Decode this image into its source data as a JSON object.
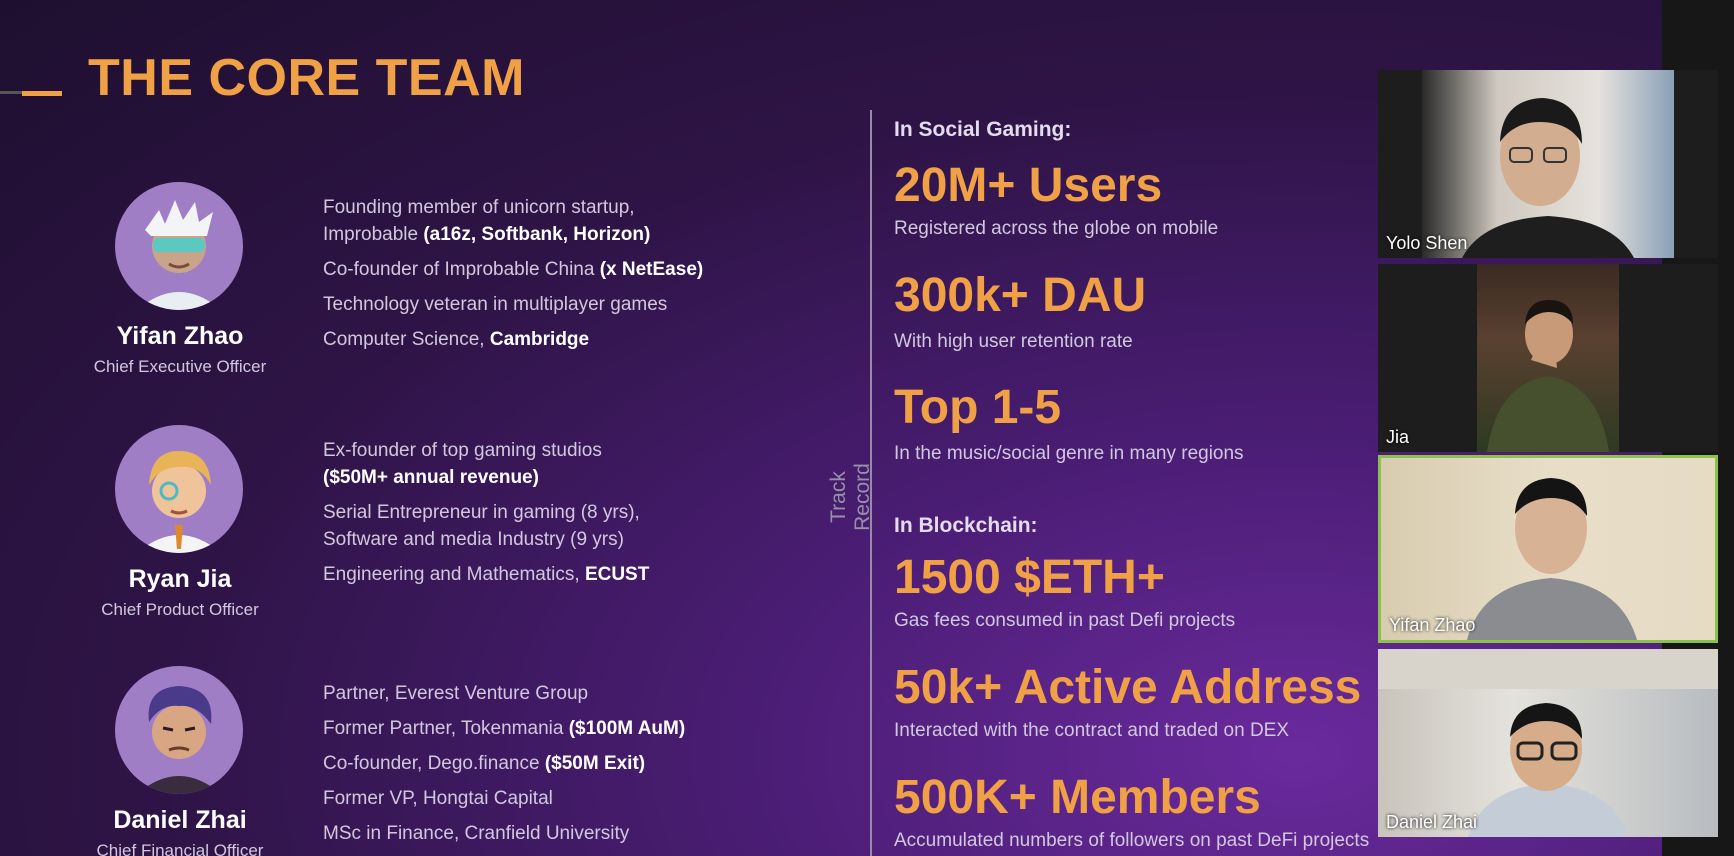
{
  "slide": {
    "title": "THE CORE TEAM",
    "team": [
      {
        "name": "Yifan Zhao",
        "role": "Chief Executive Officer",
        "bio": [
          {
            "text": "Founding member of unicorn startup,",
            "bold": ""
          },
          {
            "text": "Improbable ",
            "bold": "(a16z, Softbank, Horizon)"
          },
          {
            "text": "Co-founder of Improbable China ",
            "bold": "(x NetEase)"
          },
          {
            "text": "Technology veteran in multiplayer games",
            "bold": ""
          },
          {
            "text": "Computer Science, ",
            "bold": "Cambridge"
          }
        ]
      },
      {
        "name": "Ryan Jia",
        "role": "Chief Product Officer",
        "bio": [
          {
            "text": "Ex-founder of top gaming studios",
            "bold": ""
          },
          {
            "text": "",
            "bold": "($50M+ annual revenue)"
          },
          {
            "text": "Serial Entrepreneur in gaming (8 yrs),",
            "bold": ""
          },
          {
            "text": "Software and media Industry (9 yrs)",
            "bold": ""
          },
          {
            "text": "Engineering and Mathematics, ",
            "bold": "ECUST"
          }
        ]
      },
      {
        "name": "Daniel Zhai",
        "role": "Chief Financial Officer",
        "bio": [
          {
            "text": "Partner, Everest Venture Group",
            "bold": ""
          },
          {
            "text": "Former Partner, Tokenmania ",
            "bold": "($100M AuM)"
          },
          {
            "text": "Co-founder, Dego.finance ",
            "bold": "($50M Exit)"
          },
          {
            "text": "Former VP, Hongtai Capital",
            "bold": ""
          },
          {
            "text": "MSc in Finance, Cranfield University",
            "bold": ""
          }
        ]
      }
    ],
    "track_record_label": "Track Record",
    "social_gaming": {
      "heading": "In Social Gaming:",
      "stats": [
        {
          "value": "20M+ Users",
          "desc": "Registered across the globe on mobile"
        },
        {
          "value": "300k+ DAU",
          "desc": "With high user retention rate"
        },
        {
          "value": "Top 1-5",
          "desc": "In the music/social genre in many regions"
        }
      ]
    },
    "blockchain": {
      "heading": "In Blockchain:",
      "stats": [
        {
          "value": "1500 $ETH+",
          "desc": "Gas fees consumed in past Defi projects"
        },
        {
          "value": "50k+ Active Address",
          "desc": "Interacted with the contract and traded on DEX"
        },
        {
          "value": "500K+ Members",
          "desc": "Accumulated numbers of followers on past DeFi projects"
        }
      ]
    }
  },
  "participants": [
    {
      "name": "Yolo Shen",
      "active": false
    },
    {
      "name": "Jia",
      "active": false
    },
    {
      "name": "Yifan Zhao",
      "active": true
    },
    {
      "name": "Daniel Zhai",
      "active": false
    }
  ],
  "colors": {
    "accent": "#f0a045",
    "active_speaker": "#8bc34a"
  }
}
